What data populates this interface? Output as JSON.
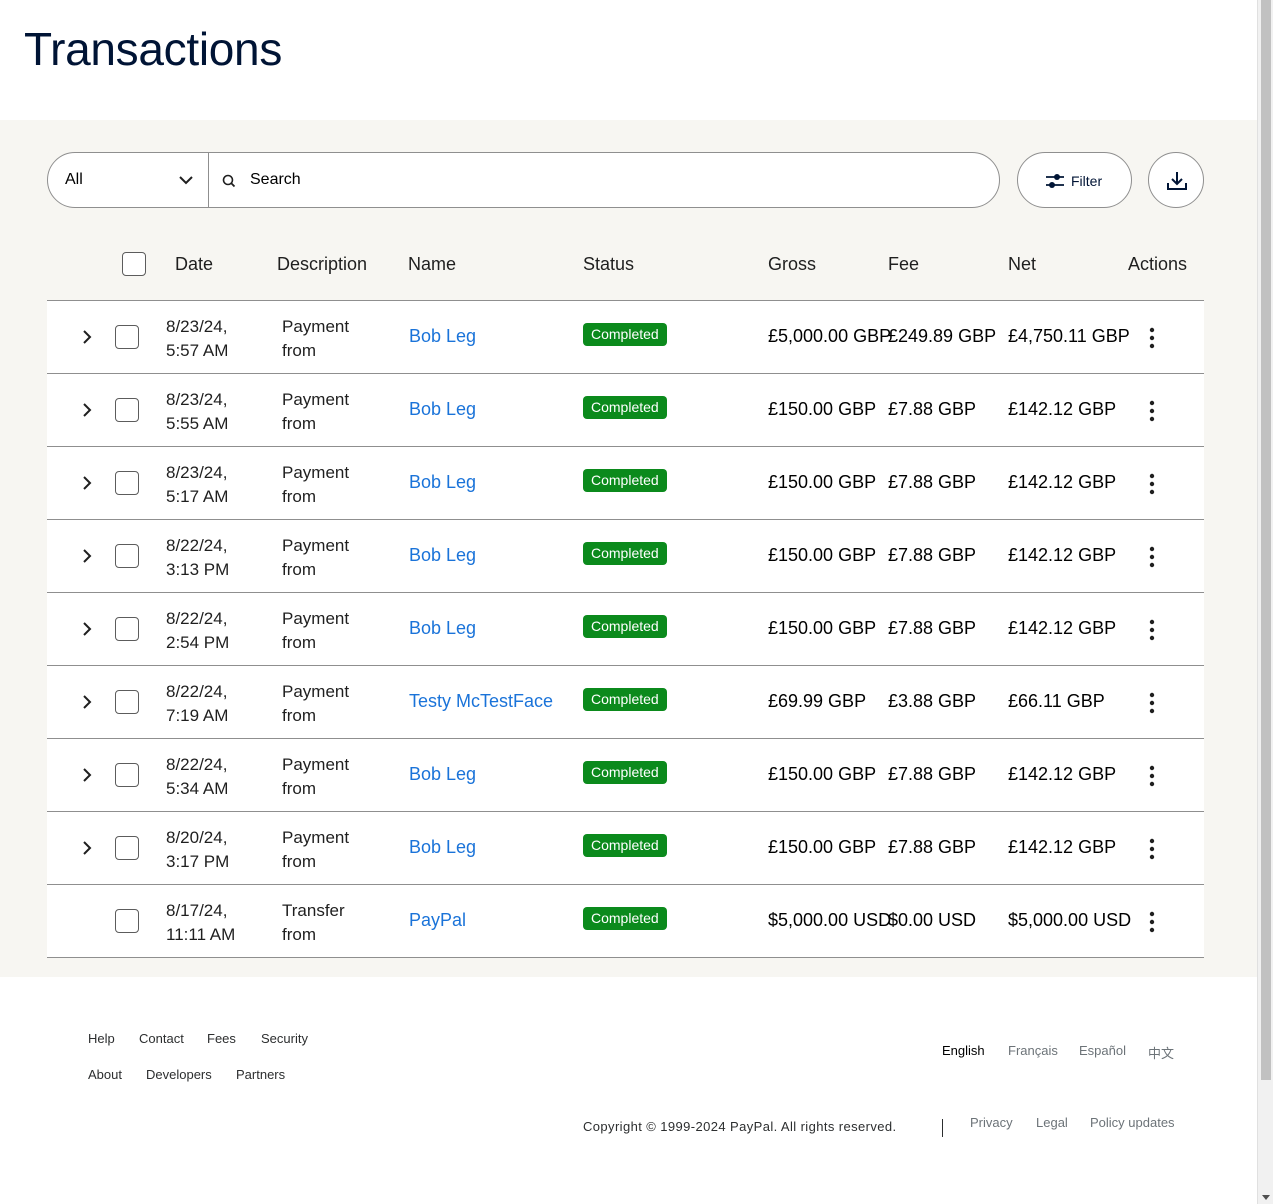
{
  "page": {
    "title": "Transactions"
  },
  "toolbar": {
    "type_select": "All",
    "search_placeholder": "Search",
    "filter_label": "Filter"
  },
  "table": {
    "headers": [
      "Date",
      "Description",
      "Name",
      "Status",
      "Gross",
      "Fee",
      "Net",
      "Actions"
    ],
    "rows": [
      {
        "date1": "8/23/24,",
        "date2": "5:57 AM",
        "desc1": "Payment",
        "desc2": "from",
        "name": "Bob Leg",
        "status": "Completed",
        "gross": "£5,000.00 GBP",
        "fee": "£249.89 GBP",
        "net": "£4,750.11 GBP",
        "expandable": true
      },
      {
        "date1": "8/23/24,",
        "date2": "5:55 AM",
        "desc1": "Payment",
        "desc2": "from",
        "name": "Bob Leg",
        "status": "Completed",
        "gross": "£150.00 GBP",
        "fee": "£7.88 GBP",
        "net": "£142.12 GBP",
        "expandable": true
      },
      {
        "date1": "8/23/24,",
        "date2": "5:17 AM",
        "desc1": "Payment",
        "desc2": "from",
        "name": "Bob Leg",
        "status": "Completed",
        "gross": "£150.00 GBP",
        "fee": "£7.88 GBP",
        "net": "£142.12 GBP",
        "expandable": true
      },
      {
        "date1": "8/22/24,",
        "date2": "3:13 PM",
        "desc1": "Payment",
        "desc2": "from",
        "name": "Bob Leg",
        "status": "Completed",
        "gross": "£150.00 GBP",
        "fee": "£7.88 GBP",
        "net": "£142.12 GBP",
        "expandable": true
      },
      {
        "date1": "8/22/24,",
        "date2": "2:54 PM",
        "desc1": "Payment",
        "desc2": "from",
        "name": "Bob Leg",
        "status": "Completed",
        "gross": "£150.00 GBP",
        "fee": "£7.88 GBP",
        "net": "£142.12 GBP",
        "expandable": true
      },
      {
        "date1": "8/22/24,",
        "date2": "7:19 AM",
        "desc1": "Payment",
        "desc2": "from",
        "name": "Testy McTestFace",
        "status": "Completed",
        "gross": "£69.99 GBP",
        "fee": "£3.88 GBP",
        "net": "£66.11 GBP",
        "expandable": true
      },
      {
        "date1": "8/22/24,",
        "date2": "5:34 AM",
        "desc1": "Payment",
        "desc2": "from",
        "name": "Bob Leg",
        "status": "Completed",
        "gross": "£150.00 GBP",
        "fee": "£7.88 GBP",
        "net": "£142.12 GBP",
        "expandable": true
      },
      {
        "date1": "8/20/24,",
        "date2": "3:17 PM",
        "desc1": "Payment",
        "desc2": "from",
        "name": "Bob Leg",
        "status": "Completed",
        "gross": "£150.00 GBP",
        "fee": "£7.88 GBP",
        "net": "£142.12 GBP",
        "expandable": true
      },
      {
        "date1": "8/17/24,",
        "date2": "11:11 AM",
        "desc1": "Transfer",
        "desc2": "from",
        "name": "PayPal",
        "status": "Completed",
        "gross": "$5,000.00 USD",
        "fee": "$0.00 USD",
        "net": "$5,000.00 USD",
        "expandable": false
      }
    ]
  },
  "footer": {
    "links_row1": [
      "Help",
      "Contact",
      "Fees",
      "Security"
    ],
    "links_row2": [
      "About",
      "Developers",
      "Partners"
    ],
    "languages": [
      "English",
      "Français",
      "Español",
      "中文"
    ],
    "copyright": "Copyright © 1999-2024 PayPal. All rights reserved.",
    "legal_links": [
      "Privacy",
      "Legal",
      "Policy updates"
    ]
  },
  "colors": {
    "link": "#1a73d9",
    "status_completed": "#0b8a1c",
    "content_bg": "#f7f6f2",
    "title": "#001435"
  }
}
